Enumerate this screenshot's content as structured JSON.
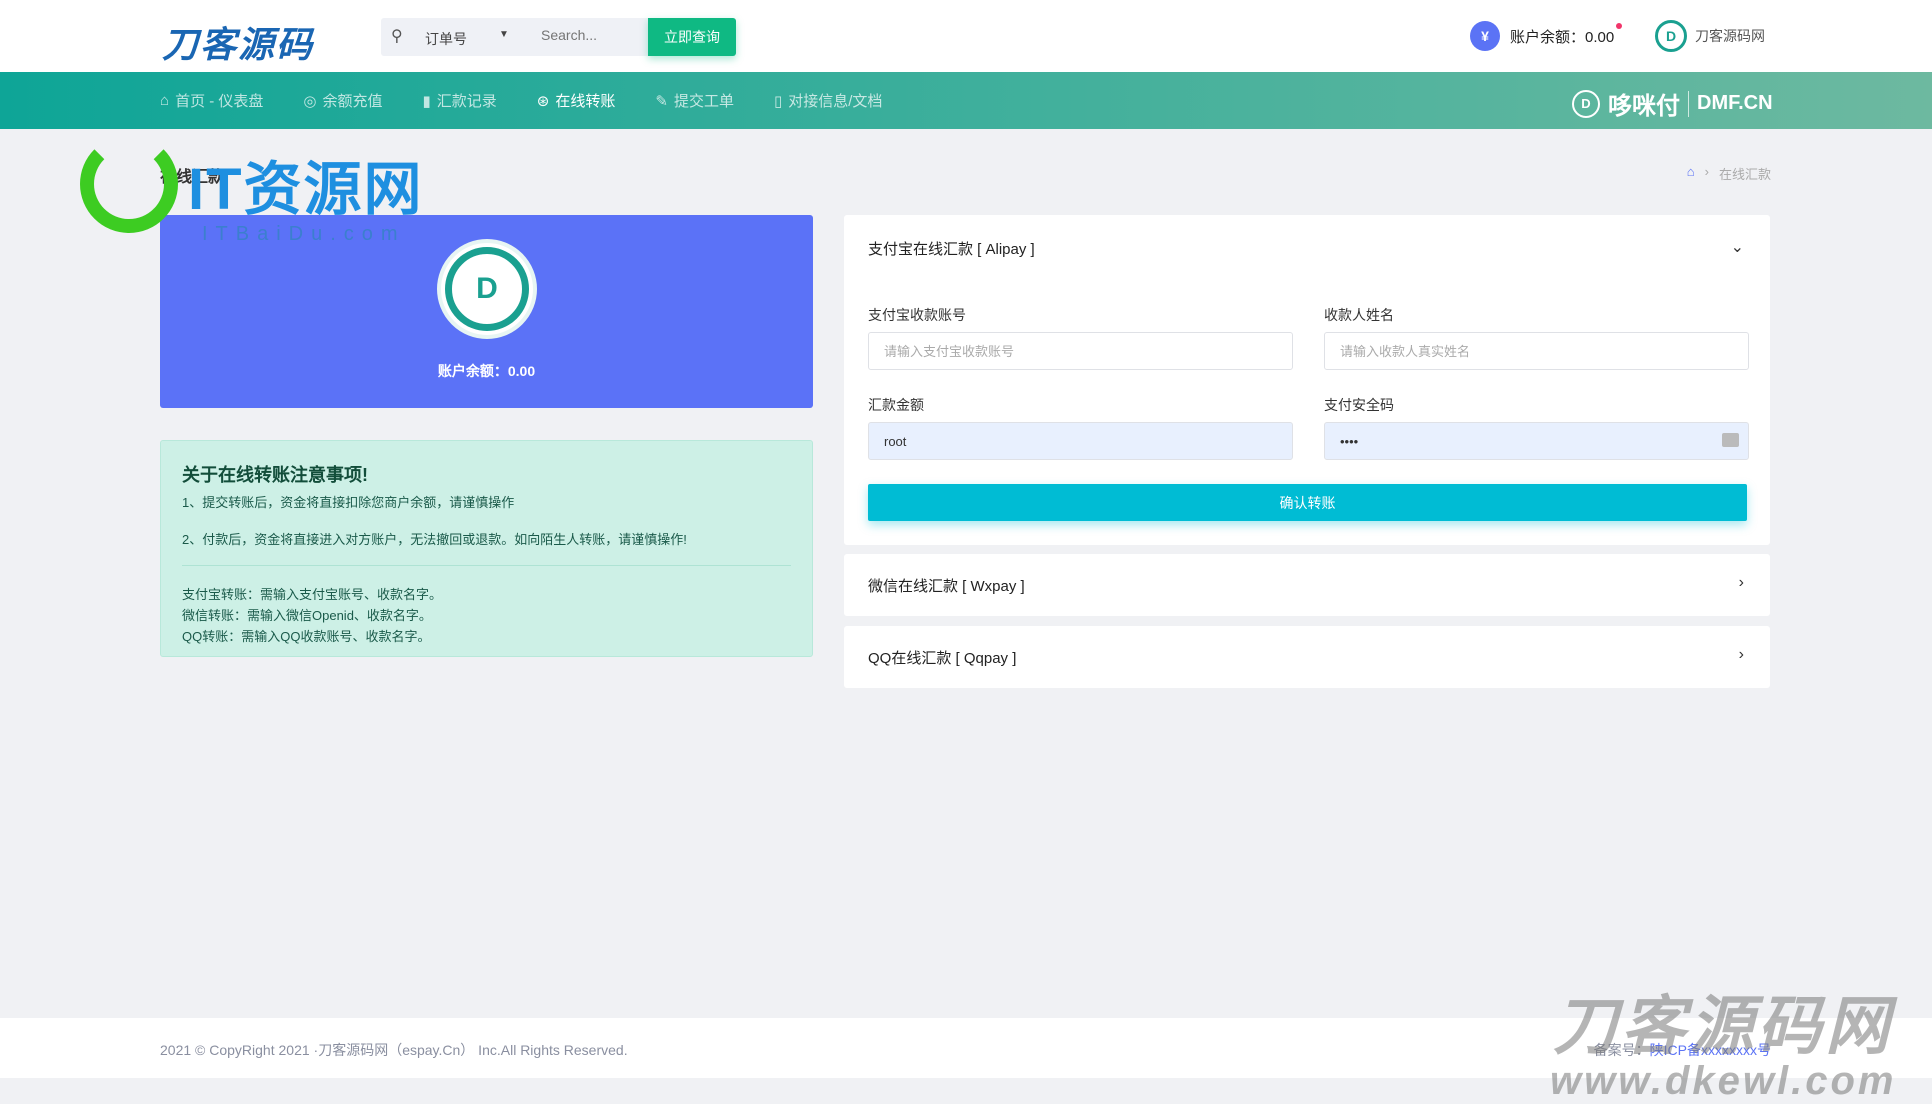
{
  "header": {
    "logo": "刀客源码",
    "search": {
      "type": "订单号",
      "placeholder": "Search...",
      "button": "立即查询"
    },
    "balance": "账户余额：0.00",
    "user": "刀客源码网"
  },
  "nav": {
    "items": [
      {
        "icon": "home-icon",
        "glyph": "⌂",
        "label": "首页 - 仪表盘"
      },
      {
        "icon": "target-icon",
        "glyph": "◎",
        "label": "余额充值"
      },
      {
        "icon": "bar-chart-icon",
        "glyph": "▮",
        "label": "汇款记录"
      },
      {
        "icon": "lifebuoy-icon",
        "glyph": "⊛",
        "label": "在线转账"
      },
      {
        "icon": "edit-icon",
        "glyph": "✎",
        "label": "提交工单"
      },
      {
        "icon": "phone-icon",
        "glyph": "▯",
        "label": "对接信息/文档"
      }
    ],
    "active": 3,
    "brand": "哆咪付",
    "brand_domain": "DMF.CN"
  },
  "page": {
    "title": "在线汇款",
    "breadcrumb": "在线汇款"
  },
  "watermarks": {
    "top_left": "IT资源网",
    "top_left_sub": "ITBaiDu.com",
    "bottom_right": "刀客源码网",
    "bottom_right_url": "www.dkewl.com"
  },
  "balance_card": {
    "text": "账户余额：0.00"
  },
  "notice": {
    "title": "关于在线转账注意事项!",
    "items": [
      "1、提交转账后，资金将直接扣除您商户余额，请谨慎操作",
      "2、付款后，资金将直接进入对方账户，无法撤回或退款。如向陌生人转账，请谨慎操作!"
    ],
    "lines": [
      "支付宝转账：需输入支付宝账号、收款名字。",
      "微信转账：需输入微信Openid、收款名字。",
      "QQ转账：需输入QQ收款账号、收款名字。"
    ]
  },
  "alipay": {
    "title": "支付宝在线汇款 [ Alipay ]",
    "account_label": "支付宝收款账号",
    "account_placeholder": "请输入支付宝收款账号",
    "name_label": "收款人姓名",
    "name_placeholder": "请输入收款人真实姓名",
    "amount_label": "汇款金额",
    "amount_value": "root",
    "pwd_label": "支付安全码",
    "pwd_value": "••••",
    "confirm": "确认转账"
  },
  "wxpay": {
    "title": "微信在线汇款 [ Wxpay ]"
  },
  "qqpay": {
    "title": "QQ在线汇款 [ Qqpay ]"
  },
  "footer": {
    "copyright": "2021 © CopyRight 2021 ·刀客源码网（espay.Cn） Inc.All Rights Reserved.",
    "icp_label": "备案号：",
    "icp": "陕ICP备xxxxxxxx号"
  },
  "colors": {
    "nav_start": "#0ea597",
    "primary": "#5b72f7",
    "confirm": "#00bcd4",
    "query": "#0fb983"
  }
}
